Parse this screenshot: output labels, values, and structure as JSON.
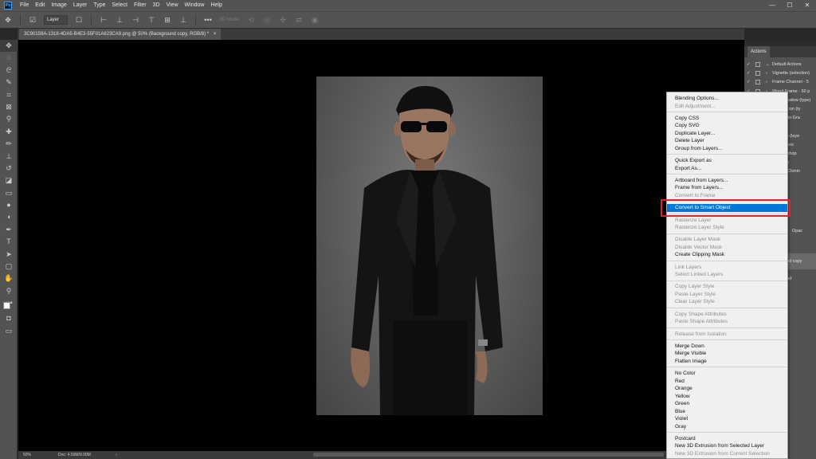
{
  "menubar": {
    "app_icon": "Ps",
    "items": [
      "File",
      "Edit",
      "Image",
      "Layer",
      "Type",
      "Select",
      "Filter",
      "3D",
      "View",
      "Window",
      "Help"
    ],
    "window_controls": [
      "—",
      "☐",
      "✕"
    ]
  },
  "options": {
    "auto_select_value": "Layer",
    "mode_3d_label": "3D Mode:",
    "more_label": "•••"
  },
  "document": {
    "tab_title": "3C90159A-1318-4DA5-B4E3-55F01A623CA9.png @ 50% (Background copy, RGB/8) *",
    "tab_close": "×"
  },
  "status": {
    "zoom": "50%",
    "doc": "Doc: 4.50M/9.00M",
    "arrow": "›"
  },
  "actions_panel": {
    "tab_label": "Actions",
    "rows": [
      {
        "label": "Default Actions"
      },
      {
        "label": "Vignette (selection)"
      },
      {
        "label": "Frame Channel - 5"
      },
      {
        "label": "Wood Frame - 50 p"
      },
      {
        "label": "Cast Shadow (type)"
      },
      {
        "label": "r Reflection (ty"
      },
      {
        "label": "m RGB to Gra"
      },
      {
        "label": "n Lead"
      },
      {
        "label": "a Toning (laye"
      },
      {
        "label": "rant Colors"
      },
      {
        "label": "s Photoshop"
      },
      {
        "label": "ient Map"
      },
      {
        "label": "r Brush Clonin"
      }
    ]
  },
  "layers_panel": {
    "opacity_label": "Opac",
    "layer_name": "und copy",
    "layer_name_2": "und"
  },
  "context_menu": {
    "items": [
      {
        "label": "Blending Options...",
        "state": "enabled"
      },
      {
        "label": "Edit Adjustment...",
        "state": "disabled"
      },
      {
        "label": "Copy CSS",
        "state": "enabled"
      },
      {
        "label": "Copy SVG",
        "state": "enabled"
      },
      {
        "label": "Duplicate Layer...",
        "state": "enabled"
      },
      {
        "label": "Delete Layer",
        "state": "enabled"
      },
      {
        "label": "Group from Layers...",
        "state": "enabled"
      },
      {
        "label": "Quick Export as",
        "state": "enabled"
      },
      {
        "label": "Export As...",
        "state": "enabled"
      },
      {
        "label": "Artboard from Layers...",
        "state": "enabled"
      },
      {
        "label": "Frame from Layers...",
        "state": "enabled"
      },
      {
        "label": "Convert to Frame",
        "state": "disabled"
      },
      {
        "label": "Convert to Smart Object",
        "state": "highlighted"
      },
      {
        "label": "Rasterize Layer",
        "state": "disabled"
      },
      {
        "label": "Rasterize Layer Style",
        "state": "disabled"
      },
      {
        "label": "Disable Layer Mask",
        "state": "disabled"
      },
      {
        "label": "Disable Vector Mask",
        "state": "disabled"
      },
      {
        "label": "Create Clipping Mask",
        "state": "enabled"
      },
      {
        "label": "Link Layers",
        "state": "disabled"
      },
      {
        "label": "Select Linked Layers",
        "state": "disabled"
      },
      {
        "label": "Copy Layer Style",
        "state": "disabled"
      },
      {
        "label": "Paste Layer Style",
        "state": "disabled"
      },
      {
        "label": "Clear Layer Style",
        "state": "disabled"
      },
      {
        "label": "Copy Shape Attributes",
        "state": "disabled"
      },
      {
        "label": "Paste Shape Attributes",
        "state": "disabled"
      },
      {
        "label": "Release from Isolation",
        "state": "disabled"
      },
      {
        "label": "Merge Down",
        "state": "enabled"
      },
      {
        "label": "Merge Visible",
        "state": "enabled"
      },
      {
        "label": "Flatten Image",
        "state": "enabled"
      },
      {
        "label": "No Color",
        "state": "enabled"
      },
      {
        "label": "Red",
        "state": "enabled"
      },
      {
        "label": "Orange",
        "state": "enabled"
      },
      {
        "label": "Yellow",
        "state": "enabled"
      },
      {
        "label": "Green",
        "state": "enabled"
      },
      {
        "label": "Blue",
        "state": "enabled"
      },
      {
        "label": "Violet",
        "state": "enabled"
      },
      {
        "label": "Gray",
        "state": "enabled"
      },
      {
        "label": "Postcard",
        "state": "enabled"
      },
      {
        "label": "New 3D Extrusion from Selected Layer",
        "state": "enabled"
      },
      {
        "label": "New 3D Extrusion from Current Selection",
        "state": "disabled"
      }
    ]
  },
  "colors": {
    "highlight": "#0078d7",
    "annotation_box": "#d9262d",
    "app_background": "#535353",
    "canvas_background": "#000000"
  }
}
